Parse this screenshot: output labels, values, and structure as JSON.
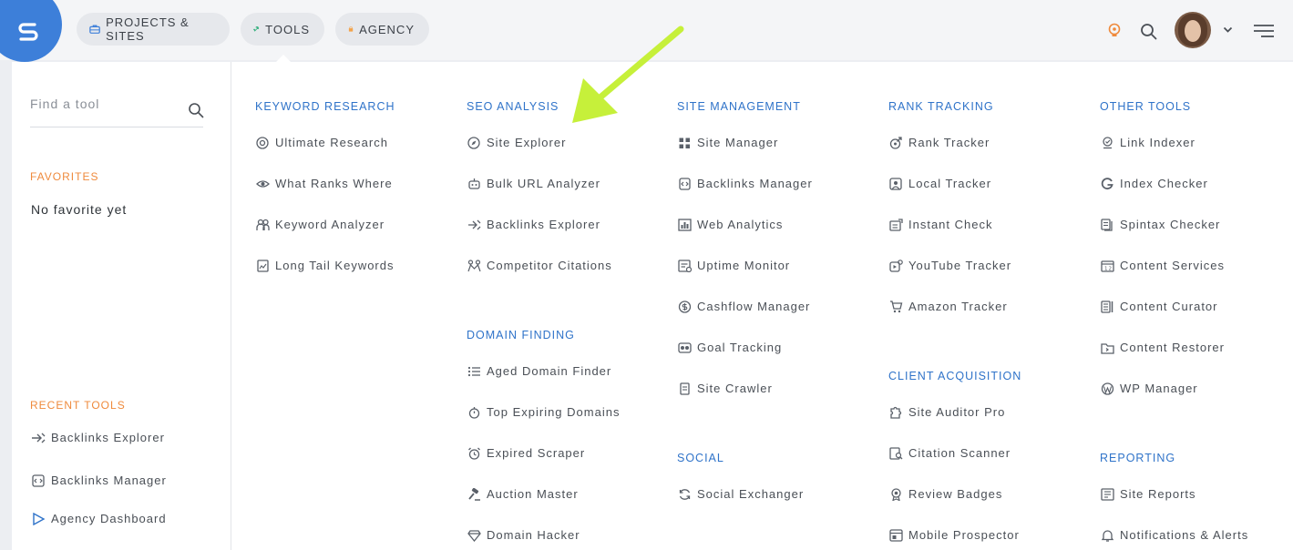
{
  "header": {
    "nav": [
      {
        "label": "PROJECTS & SITES",
        "icon": "briefcase-icon"
      },
      {
        "label": "TOOLS",
        "icon": "tools-icon"
      },
      {
        "label": "AGENCY",
        "icon": "agency-icon"
      }
    ]
  },
  "sidebar": {
    "search_placeholder": "Find a tool",
    "favorites_title": "FAVORITES",
    "favorites_empty": "No favorite yet",
    "recent_title": "RECENT TOOLS",
    "recent": [
      "Backlinks Explorer",
      "Backlinks Manager",
      "Agency Dashboard"
    ]
  },
  "columns": {
    "keyword_research": {
      "title": "KEYWORD RESEARCH",
      "items": [
        "Ultimate Research",
        "What Ranks Where",
        "Keyword Analyzer",
        "Long Tail Keywords"
      ]
    },
    "seo_analysis": {
      "title": "SEO ANALYSIS",
      "items": [
        "Site Explorer",
        "Bulk URL Analyzer",
        "Backlinks Explorer",
        "Competitor Citations"
      ]
    },
    "domain_finding": {
      "title": "DOMAIN FINDING",
      "items": [
        "Aged Domain Finder",
        "Top Expiring Domains",
        "Expired Scraper",
        "Auction Master",
        "Domain Hacker"
      ]
    },
    "site_management": {
      "title": "SITE MANAGEMENT",
      "items": [
        "Site Manager",
        "Backlinks Manager",
        "Web Analytics",
        "Uptime Monitor",
        "Cashflow Manager",
        "Goal Tracking",
        "Site Crawler"
      ]
    },
    "social": {
      "title": "SOCIAL",
      "items": [
        "Social Exchanger"
      ]
    },
    "rank_tracking": {
      "title": "RANK TRACKING",
      "items": [
        "Rank Tracker",
        "Local Tracker",
        "Instant Check",
        "YouTube Tracker",
        "Amazon Tracker"
      ]
    },
    "client_acquisition": {
      "title": "CLIENT ACQUISITION",
      "items": [
        "Site Auditor Pro",
        "Citation Scanner",
        "Review Badges",
        "Mobile Prospector"
      ]
    },
    "other_tools": {
      "title": "OTHER TOOLS",
      "items": [
        "Link Indexer",
        "Index Checker",
        "Spintax Checker",
        "Content Services",
        "Content Curator",
        "Content Restorer",
        "WP Manager"
      ]
    },
    "reporting": {
      "title": "REPORTING",
      "items": [
        "Site Reports",
        "Notifications & Alerts"
      ]
    }
  },
  "colors": {
    "accent_blue": "#2f73c9",
    "accent_orange": "#ef8a3c",
    "arrow": "#c6f03a",
    "logo": "#3d7fd9"
  }
}
